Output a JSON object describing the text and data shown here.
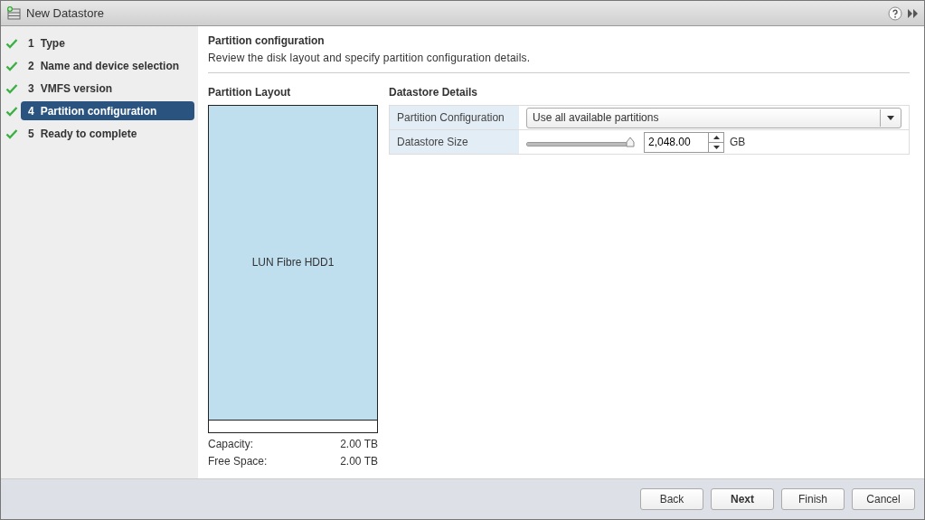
{
  "window": {
    "title": "New Datastore"
  },
  "steps": [
    {
      "number": "1",
      "label": "Type",
      "completed": true,
      "selected": false
    },
    {
      "number": "2",
      "label": "Name and device selection",
      "completed": true,
      "selected": false
    },
    {
      "number": "3",
      "label": "VMFS version",
      "completed": true,
      "selected": false
    },
    {
      "number": "4",
      "label": "Partition configuration",
      "completed": true,
      "selected": true
    },
    {
      "number": "5",
      "label": "Ready to complete",
      "completed": true,
      "selected": false
    }
  ],
  "page": {
    "title": "Partition configuration",
    "description": "Review the disk layout and specify partition configuration details."
  },
  "partition_layout": {
    "heading": "Partition Layout",
    "disk_label": "LUN Fibre HDD1",
    "level": 0.96,
    "stats": [
      {
        "label": "Capacity:",
        "value": "2.00 TB"
      },
      {
        "label": "Free Space:",
        "value": "2.00 TB"
      }
    ]
  },
  "datastore_details": {
    "heading": "Datastore Details",
    "partition_configuration": {
      "label": "Partition Configuration",
      "value": "Use all available partitions"
    },
    "datastore_size": {
      "label": "Datastore Size",
      "level": 1,
      "value": "2,048.00",
      "unit": "GB"
    }
  },
  "buttons": [
    {
      "label": "Back",
      "primary": false
    },
    {
      "label": "Next",
      "primary": true
    },
    {
      "label": "Finish",
      "primary": false
    },
    {
      "label": "Cancel",
      "primary": false
    }
  ]
}
